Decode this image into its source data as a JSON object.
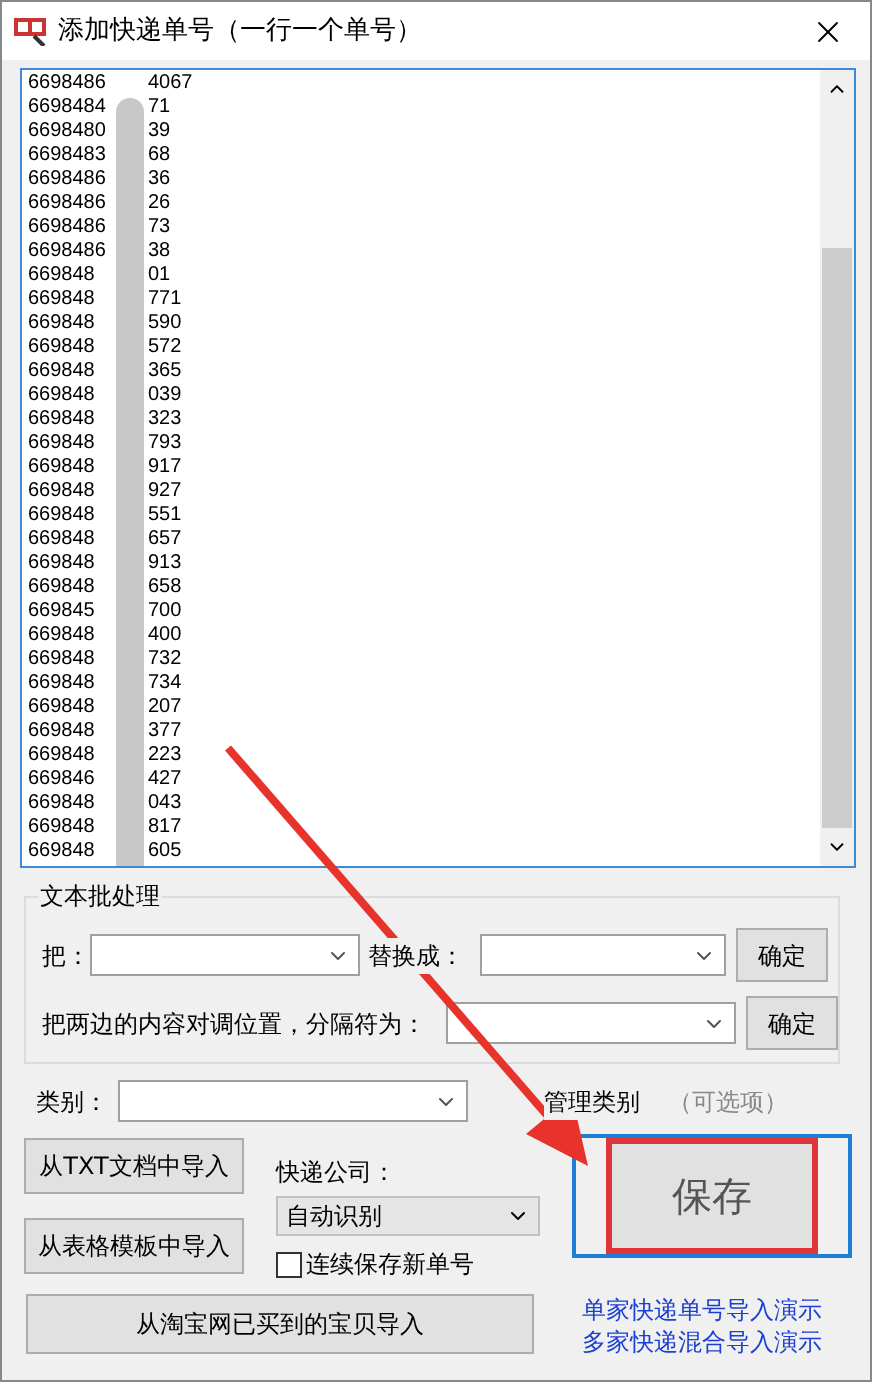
{
  "window": {
    "title": "添加快递单号（一行一个单号）"
  },
  "numbers": [
    {
      "start": "6698486",
      "end": "4067"
    },
    {
      "start": "6698484",
      "end": "71"
    },
    {
      "start": "6698480",
      "end": "39"
    },
    {
      "start": "6698483",
      "end": "68"
    },
    {
      "start": "6698486",
      "end": "36"
    },
    {
      "start": "6698486",
      "end": "26"
    },
    {
      "start": "6698486",
      "end": "73"
    },
    {
      "start": "6698486",
      "end": "38"
    },
    {
      "start": "669848",
      "end": "01"
    },
    {
      "start": "669848",
      "end": "771"
    },
    {
      "start": "669848",
      "end": "590"
    },
    {
      "start": "669848",
      "end": "572"
    },
    {
      "start": "669848",
      "end": "365"
    },
    {
      "start": "669848",
      "end": "039"
    },
    {
      "start": "669848",
      "end": "323"
    },
    {
      "start": "669848",
      "end": "793"
    },
    {
      "start": "669848",
      "end": "917"
    },
    {
      "start": "669848",
      "end": "927"
    },
    {
      "start": "669848",
      "end": "551"
    },
    {
      "start": "669848",
      "end": "657"
    },
    {
      "start": "669848",
      "end": "913"
    },
    {
      "start": "669848",
      "end": "658"
    },
    {
      "start": "669845",
      "end": "700"
    },
    {
      "start": "669848",
      "end": "400"
    },
    {
      "start": "669848",
      "end": "732"
    },
    {
      "start": "669848",
      "end": "734"
    },
    {
      "start": "669848",
      "end": "207"
    },
    {
      "start": "669848",
      "end": "377"
    },
    {
      "start": "669848",
      "end": "223"
    },
    {
      "start": "669846",
      "end": "427"
    },
    {
      "start": "669848",
      "end": "043"
    },
    {
      "start": "669848",
      "end": "817"
    },
    {
      "start": "669848",
      "end": "605"
    }
  ],
  "batch": {
    "title": "文本批处理",
    "replace_from_label": "把：",
    "replace_to_label": "替换成：",
    "confirm_replace": "确定",
    "swap_label": "把两边的内容对调位置，分隔符为：",
    "confirm_swap": "确定"
  },
  "category": {
    "label": "类别：",
    "manage": "管理类别",
    "optional": "（可选项）"
  },
  "import_buttons": [
    "从TXT文档中导入",
    "从表格模板中导入"
  ],
  "courier": {
    "label": "快递公司：",
    "value": "自动识别"
  },
  "continuous_save": {
    "label": "连续保存新单号",
    "checked": false
  },
  "taobao_button": "从淘宝网已买到的宝贝导入",
  "save_button": "保存",
  "links": [
    "单家快递单号导入演示",
    "多家快递混合导入演示"
  ]
}
